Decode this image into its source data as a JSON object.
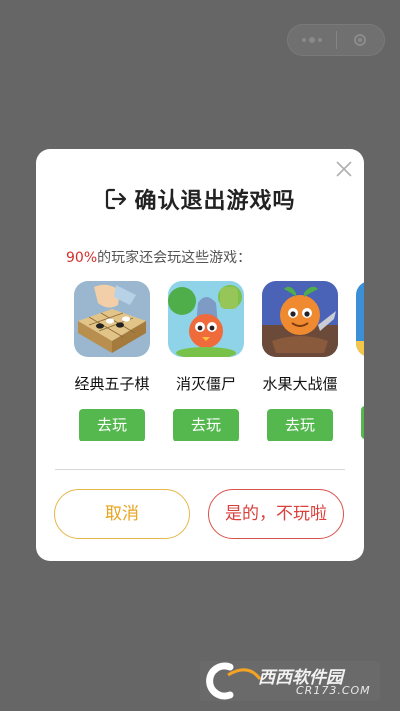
{
  "dialog": {
    "title": "确认退出游戏吗",
    "subtitle_pct": "90%",
    "subtitle_text": "的玩家还会玩这些游戏：",
    "games": [
      {
        "name": "经典五子棋",
        "play_label": "去玩"
      },
      {
        "name": "消灭僵尸",
        "play_label": "去玩"
      },
      {
        "name": "水果大战僵",
        "play_label": "去玩"
      }
    ],
    "cancel_label": "取消",
    "confirm_label": "是的，不玩啦"
  },
  "watermark": {
    "brand": "西西软件园",
    "url": "CR173.COM"
  },
  "icons": {
    "close": "close-icon",
    "exit": "exit-icon",
    "more": "more-dots-icon",
    "mini_close": "capsule-close-icon"
  },
  "colors": {
    "play_button": "#55b84f",
    "cancel": "#e8a420",
    "confirm": "#d9413c",
    "percent": "#d2302d"
  }
}
